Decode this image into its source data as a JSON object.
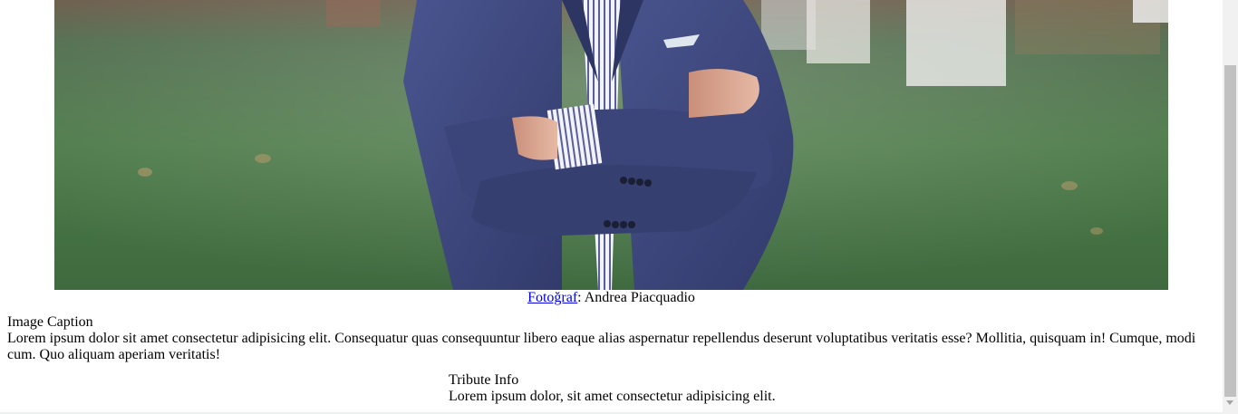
{
  "photo": {
    "alt": "Man in navy suit with arms crossed standing on grass"
  },
  "credit": {
    "link_label": "Fotoğraf",
    "separator": ": ",
    "author": "Andrea Piacquadio"
  },
  "caption": {
    "title": "Image Caption",
    "text": "Lorem ipsum dolor sit amet consectetur adipisicing elit. Consequatur quas consequuntur libero eaque alias aspernatur repellendus deserunt voluptatibus veritatis esse? Mollitia, quisquam in! Cumque, modi cum. Quo aliquam aperiam veritatis!"
  },
  "tribute": {
    "title": "Tribute Info",
    "text": "Lorem ipsum dolor, sit amet consectetur adipisicing elit."
  },
  "colors": {
    "link": "#0000ee",
    "suit": "#3f4a7c",
    "grass": "#4f7a4a"
  }
}
